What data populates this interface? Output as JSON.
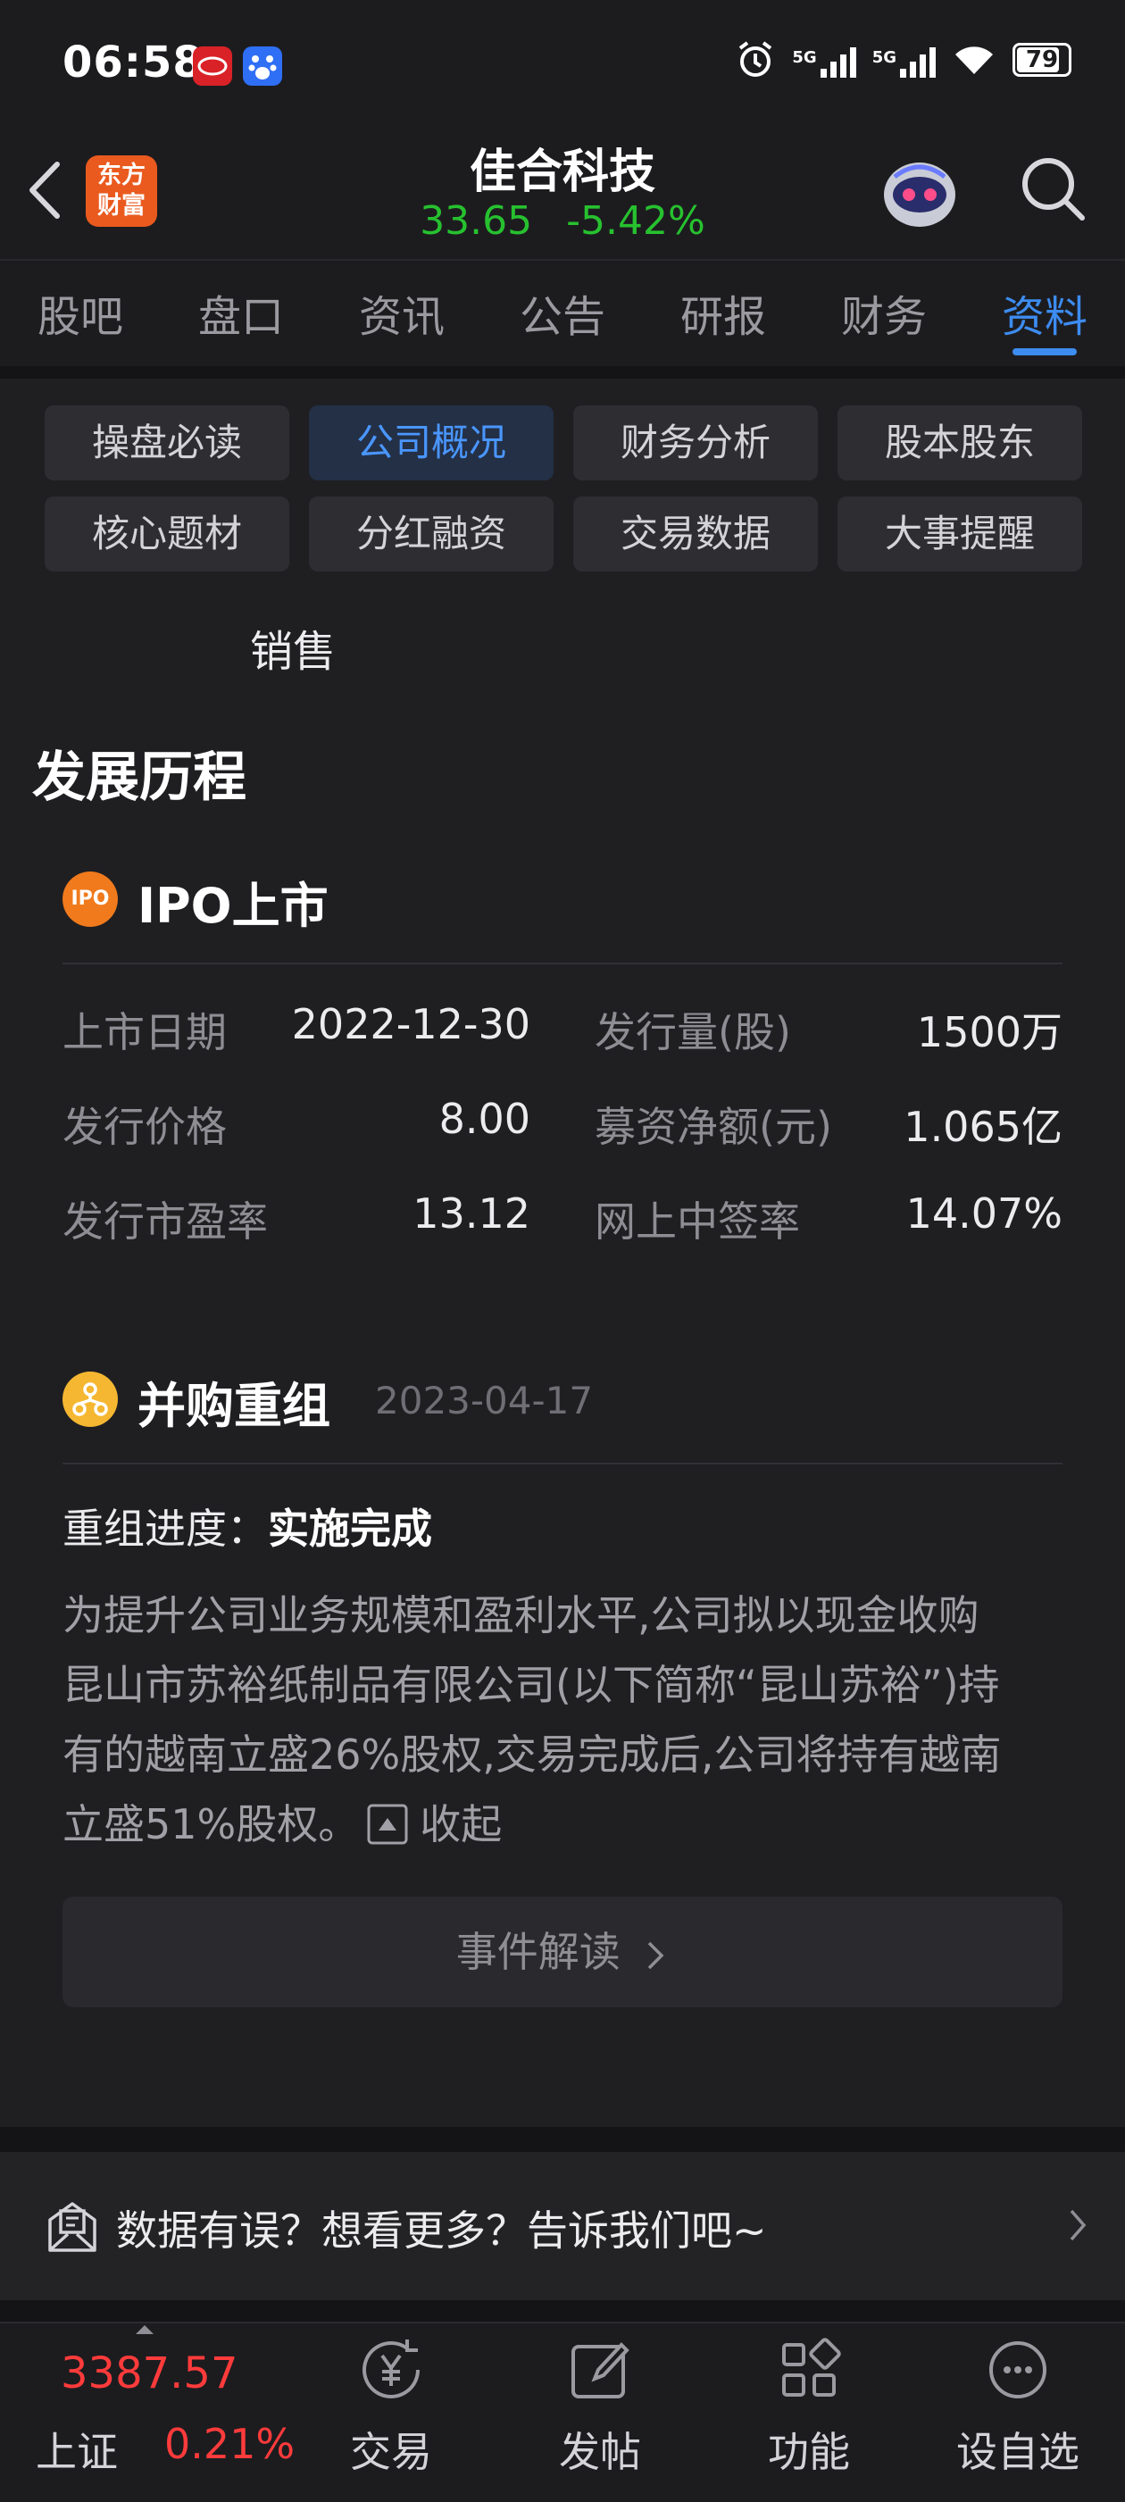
{
  "status_bar": {
    "time": "06:58",
    "battery": "79",
    "signal_label_1": "5G",
    "signal_label_2": "5G"
  },
  "header": {
    "logo_line1": "东方",
    "logo_line2": "财富",
    "stock_name": "佳合科技",
    "price": "33.65",
    "change_pct": "-5.42%"
  },
  "tabs": [
    "股吧",
    "盘口",
    "资讯",
    "公告",
    "研报",
    "财务",
    "资料"
  ],
  "active_tab": "资料",
  "sub_tabs": [
    "操盘必读",
    "公司概况",
    "财务分析",
    "股本股东",
    "核心题材",
    "分红融资",
    "交易数据",
    "大事提醒"
  ],
  "active_sub_tab": "公司概况",
  "partial_text": "销售",
  "history": {
    "title": "发展历程",
    "ipo": {
      "icon_text": "IPO",
      "title": "IPO上市",
      "rows": [
        {
          "l1": "上市日期",
          "v1": "2022-12-30",
          "l2": "发行量(股)",
          "v2": "1500万"
        },
        {
          "l1": "发行价格",
          "v1": "8.00",
          "l2": "募资净额(元)",
          "v2": "1.065亿"
        },
        {
          "l1": "发行市盈率",
          "v1": "13.12",
          "l2": "网上中签率",
          "v2": "14.07%"
        }
      ]
    },
    "merger": {
      "title": "并购重组",
      "date": "2023-04-17",
      "progress_label": "重组进度：",
      "progress_value": "实施完成",
      "description_lines": [
        "为提升公司业务规模和盈利水平,公司拟以现金收购",
        "昆山市苏裕纸制品有限公司(以下简称“昆山苏裕”)持",
        "有的越南立盛26%股权,交易完成后,公司将持有越南",
        "立盛51%股权。"
      ],
      "collapse_label": "收起",
      "event_button": "事件解读"
    }
  },
  "feedback": {
    "text": "数据有误？想看更多？告诉我们吧~"
  },
  "bottom_nav": {
    "index_value": "3387.57",
    "index_name": "上证",
    "index_change": "0.21%",
    "items": [
      "交易",
      "发帖",
      "功能",
      "设自选"
    ]
  },
  "colors": {
    "accent": "#3d8cf0",
    "down": "#27c12f",
    "up": "#ff3b3b",
    "background": "#1f1f22"
  }
}
